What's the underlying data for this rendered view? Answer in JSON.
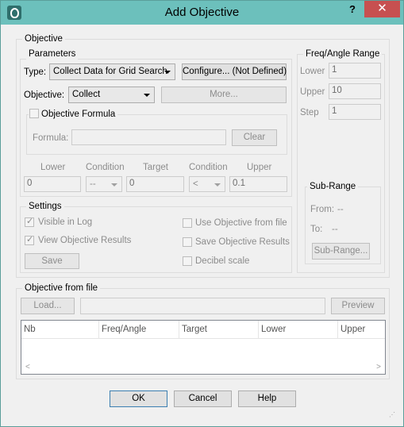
{
  "window": {
    "title": "Add Objective",
    "help": "?",
    "close": "✕"
  },
  "objective_group": {
    "label": "Objective",
    "parameters": {
      "label": "Parameters",
      "type_label": "Type:",
      "type_value": "Collect Data for Grid Search",
      "configure_button": "Configure... (Not Defined)",
      "objective_label": "Objective:",
      "objective_value": "Collect",
      "more_button": "More...",
      "formula_group": {
        "checkbox_label": "Objective Formula",
        "formula_label": "Formula:",
        "formula_value": "",
        "clear_button": "Clear"
      },
      "bounds": {
        "headers": [
          "Lower",
          "Condition",
          "Target",
          "Condition",
          "Upper"
        ],
        "lower": "0",
        "condition1": "--",
        "target": "0",
        "condition2": "<",
        "upper": "0.1"
      }
    },
    "settings": {
      "label": "Settings",
      "visible_in_log": "Visible in Log",
      "view_objective_results": "View Objective Results",
      "save_button": "Save",
      "use_objective_from_file": "Use Objective from file",
      "save_objective_results": "Save Objective Results",
      "decibel_scale": "Decibel scale"
    },
    "freq_range": {
      "label": "Freq/Angle Range",
      "lower_label": "Lower",
      "lower_value": "1",
      "upper_label": "Upper",
      "upper_value": "10",
      "step_label": "Step",
      "step_value": "1"
    },
    "sub_range": {
      "label": "Sub-Range",
      "from_label": "From:",
      "from_value": "--",
      "to_label": "To:",
      "to_value": "--",
      "button": "Sub-Range..."
    }
  },
  "file_group": {
    "label": "Objective from file",
    "load_button": "Load...",
    "path_value": "",
    "preview_button": "Preview",
    "columns": [
      "Nb",
      "Freq/Angle",
      "Target",
      "Lower",
      "Upper"
    ]
  },
  "footer": {
    "ok": "OK",
    "cancel": "Cancel",
    "help": "Help"
  }
}
